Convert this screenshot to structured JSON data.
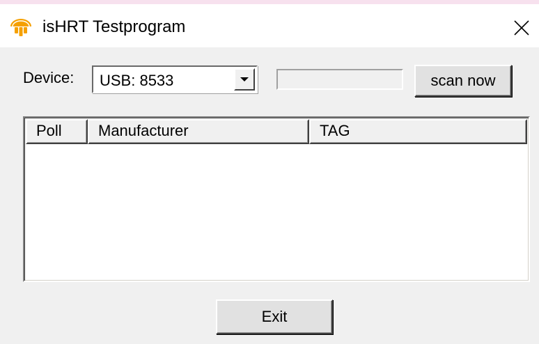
{
  "window": {
    "title": "isHRT Testprogram",
    "icon": "ishrt-app-icon",
    "close_icon": "close-icon"
  },
  "device": {
    "label": "Device:",
    "selected": "USB: 8533",
    "dropdown_icon": "chevron-down-icon"
  },
  "progress": {
    "value": 0
  },
  "buttons": {
    "scan": "scan now",
    "exit": "Exit"
  },
  "list": {
    "columns": [
      "Poll",
      "Manufacturer",
      "TAG"
    ],
    "rows": []
  },
  "colors": {
    "accent": "#f5a000",
    "progress_fill": "#06b025"
  }
}
